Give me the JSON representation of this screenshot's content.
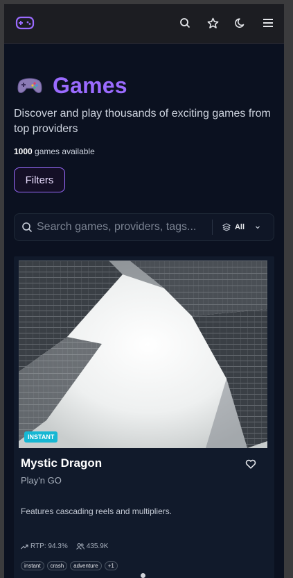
{
  "header": {
    "logo_icon": "gamepad-icon",
    "actions": [
      {
        "icon": "search-icon"
      },
      {
        "icon": "star-icon"
      },
      {
        "icon": "moon-icon"
      },
      {
        "icon": "menu-icon"
      }
    ]
  },
  "page": {
    "emoji": "🎮",
    "title": "Games",
    "subtitle": "Discover and play thousands of exciting games from top providers",
    "count": "1000",
    "count_suffix": " games available",
    "filters_label": "Filters"
  },
  "search": {
    "placeholder": "Search games, providers, tags...",
    "filter_label": "All"
  },
  "game": {
    "badge": "INSTANT",
    "title": "Mystic Dragon",
    "provider": "Play'n GO",
    "description": "Features cascading reels and multipliers.",
    "rtp": "RTP: 94.3%",
    "players": "435.9K",
    "tags": [
      "instant",
      "crash",
      "adventure",
      "+1"
    ]
  },
  "colors": {
    "accent": "#9b6bff",
    "badge": "#16b7d3",
    "background": "#0b1120"
  }
}
